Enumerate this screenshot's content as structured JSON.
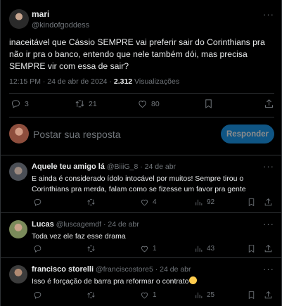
{
  "tweet": {
    "author_name": "mari",
    "author_handle": "@kindofgoddess",
    "more_icon": "more-icon",
    "text": "inaceitável que Cássio SEMPRE vai preferir sair do Corinthians pra não ir pra o banco, entendo que nele também dói, mas precisa SEMPRE vir com essa de sair?",
    "time": "12:15 PM · 24 de abr de 2024 · ",
    "views_count": "2.312",
    "views_label": " Visualizações",
    "actions": {
      "reply_count": "3",
      "retweet_count": "21",
      "like_count": "80"
    }
  },
  "composer": {
    "placeholder": "Postar sua resposta",
    "button_label": "Responder"
  },
  "replies": [
    {
      "name": "Aquele teu amigo lá",
      "meta": " @BiiiG_8 · 24 de abr",
      "text": "E ainda é considerado ídolo intocável por muitos! Sempre tirou o Corinthians pra merda, falam como se fizesse um favor pra gente",
      "likes": "4",
      "views": "92"
    },
    {
      "name": "Lucas",
      "meta": " @luscagemdf · 24 de abr",
      "text": "Toda vez ele faz esse drama",
      "likes": "1",
      "views": "43"
    },
    {
      "name": "francisco storelli",
      "meta": " @franciscostore5 · 24 de abr",
      "text": "Isso é forçação de barra pra reformar o contrato",
      "likes": "1",
      "views": "25"
    }
  ],
  "colors": {
    "background": "#000000",
    "text": "#e7e9ea",
    "muted": "#71767b",
    "accent": "#1d9bf0",
    "border": "#2f3336"
  }
}
